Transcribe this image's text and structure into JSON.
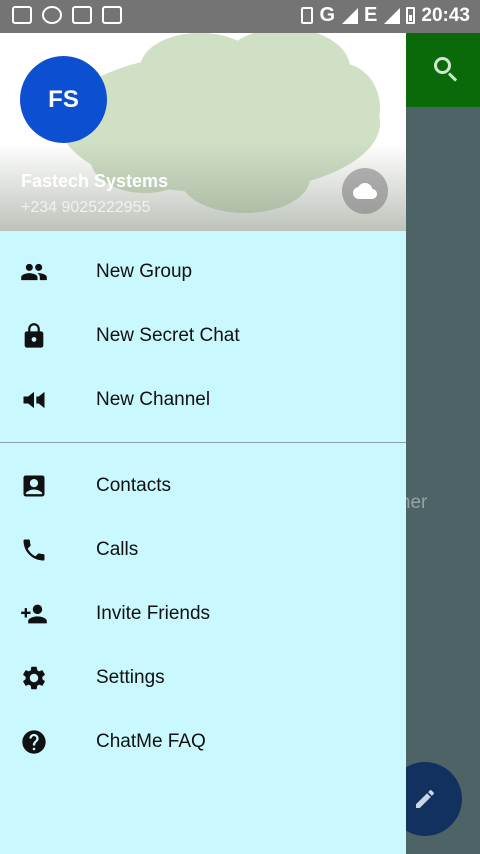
{
  "status_bar": {
    "network": "G",
    "network_secondary": "E",
    "time": "20:43",
    "icons": [
      "gmail-icon",
      "whatsapp-icon",
      "image-icon",
      "message-icon",
      "vibrate-icon",
      "signal-icon",
      "battery-icon"
    ]
  },
  "background": {
    "hint_text": "orner\ns.",
    "app_bar_color": "#0a6a0a",
    "fab_color": "#12315e"
  },
  "drawer": {
    "avatar_initials": "FS",
    "avatar_color": "#0d4fd1",
    "user_name": "Fastech Systems",
    "user_phone": "+234 9025222955",
    "background_color": "#c9f8ff",
    "menu_primary": [
      {
        "label": "New Group",
        "icon": "group-icon"
      },
      {
        "label": "New Secret Chat",
        "icon": "lock-icon"
      },
      {
        "label": "New Channel",
        "icon": "megaphone-icon"
      }
    ],
    "menu_secondary": [
      {
        "label": "Contacts",
        "icon": "contacts-icon"
      },
      {
        "label": "Calls",
        "icon": "phone-icon"
      },
      {
        "label": "Invite Friends",
        "icon": "add-person-icon"
      },
      {
        "label": "Settings",
        "icon": "gear-icon"
      },
      {
        "label": "ChatMe FAQ",
        "icon": "help-icon"
      }
    ]
  }
}
